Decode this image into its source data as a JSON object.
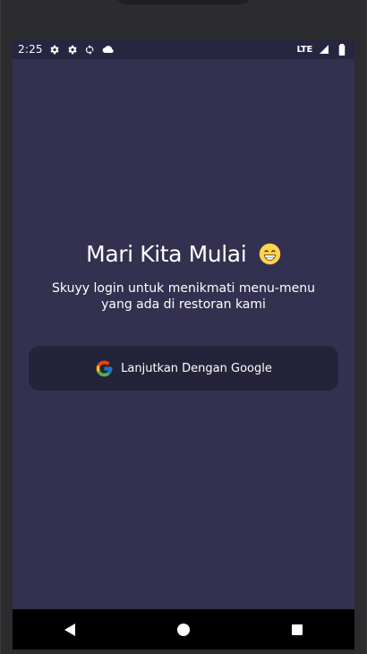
{
  "status_bar": {
    "time": "2:25",
    "network": "LTE",
    "icons": [
      "settings-icon",
      "settings-icon",
      "sync-icon",
      "cloud-icon",
      "signal-icon",
      "battery-icon"
    ]
  },
  "login": {
    "title": "Mari Kita Mulai",
    "subtitle": "Skuyy login untuk menikmati menu-menu yang ada di restoran kami",
    "button_label": "Lanjutkan Dengan Google"
  },
  "navigation": {
    "buttons": [
      "back-button",
      "home-button",
      "recents-button"
    ]
  },
  "colors": {
    "screen_background": "#33314f",
    "status_bar": "#262640",
    "button_background": "#242339",
    "nav_bar": "#000000",
    "text": "#ffffff"
  }
}
